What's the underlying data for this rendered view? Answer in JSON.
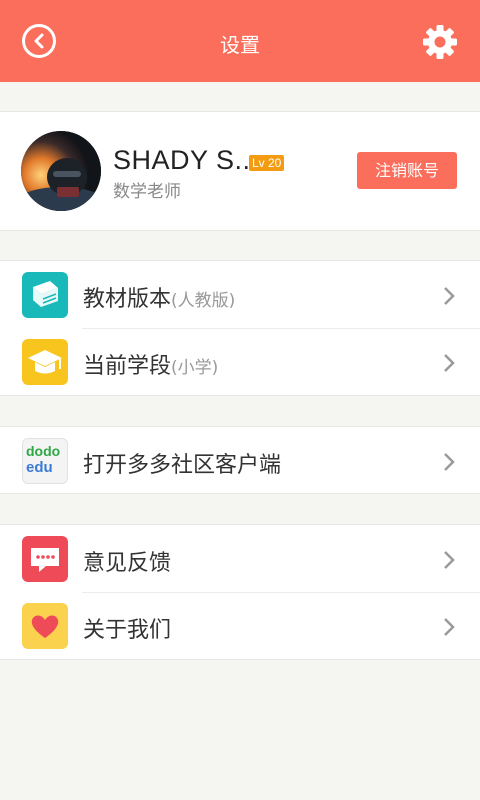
{
  "header": {
    "title": "设置",
    "back_icon": "back-arrow-icon",
    "settings_icon": "gear-icon"
  },
  "profile": {
    "name": "SHADY S...",
    "level": "Lv 20",
    "role": "数学老师",
    "logout_label": "注销账号"
  },
  "menu": {
    "textbook": {
      "label": "教材版本",
      "sub": "(人教版)",
      "icon": "book-icon"
    },
    "stage": {
      "label": "当前学段",
      "sub": "(小学)",
      "icon": "graduation-cap-icon"
    },
    "dodo": {
      "label": "打开多多社区客户端",
      "icon": "dodo-edu-logo",
      "logo_line1": "dodo",
      "logo_line2": "edu"
    },
    "feedback": {
      "label": "意见反馈",
      "icon": "chat-bubble-icon"
    },
    "about": {
      "label": "关于我们",
      "icon": "heart-icon"
    }
  },
  "colors": {
    "accent": "#fb6e5c",
    "book": "#19b9b9",
    "cap": "#f7c51d",
    "feedback": "#ef4a58",
    "heart_bg": "#fbd24e",
    "level": "#f39c12"
  }
}
